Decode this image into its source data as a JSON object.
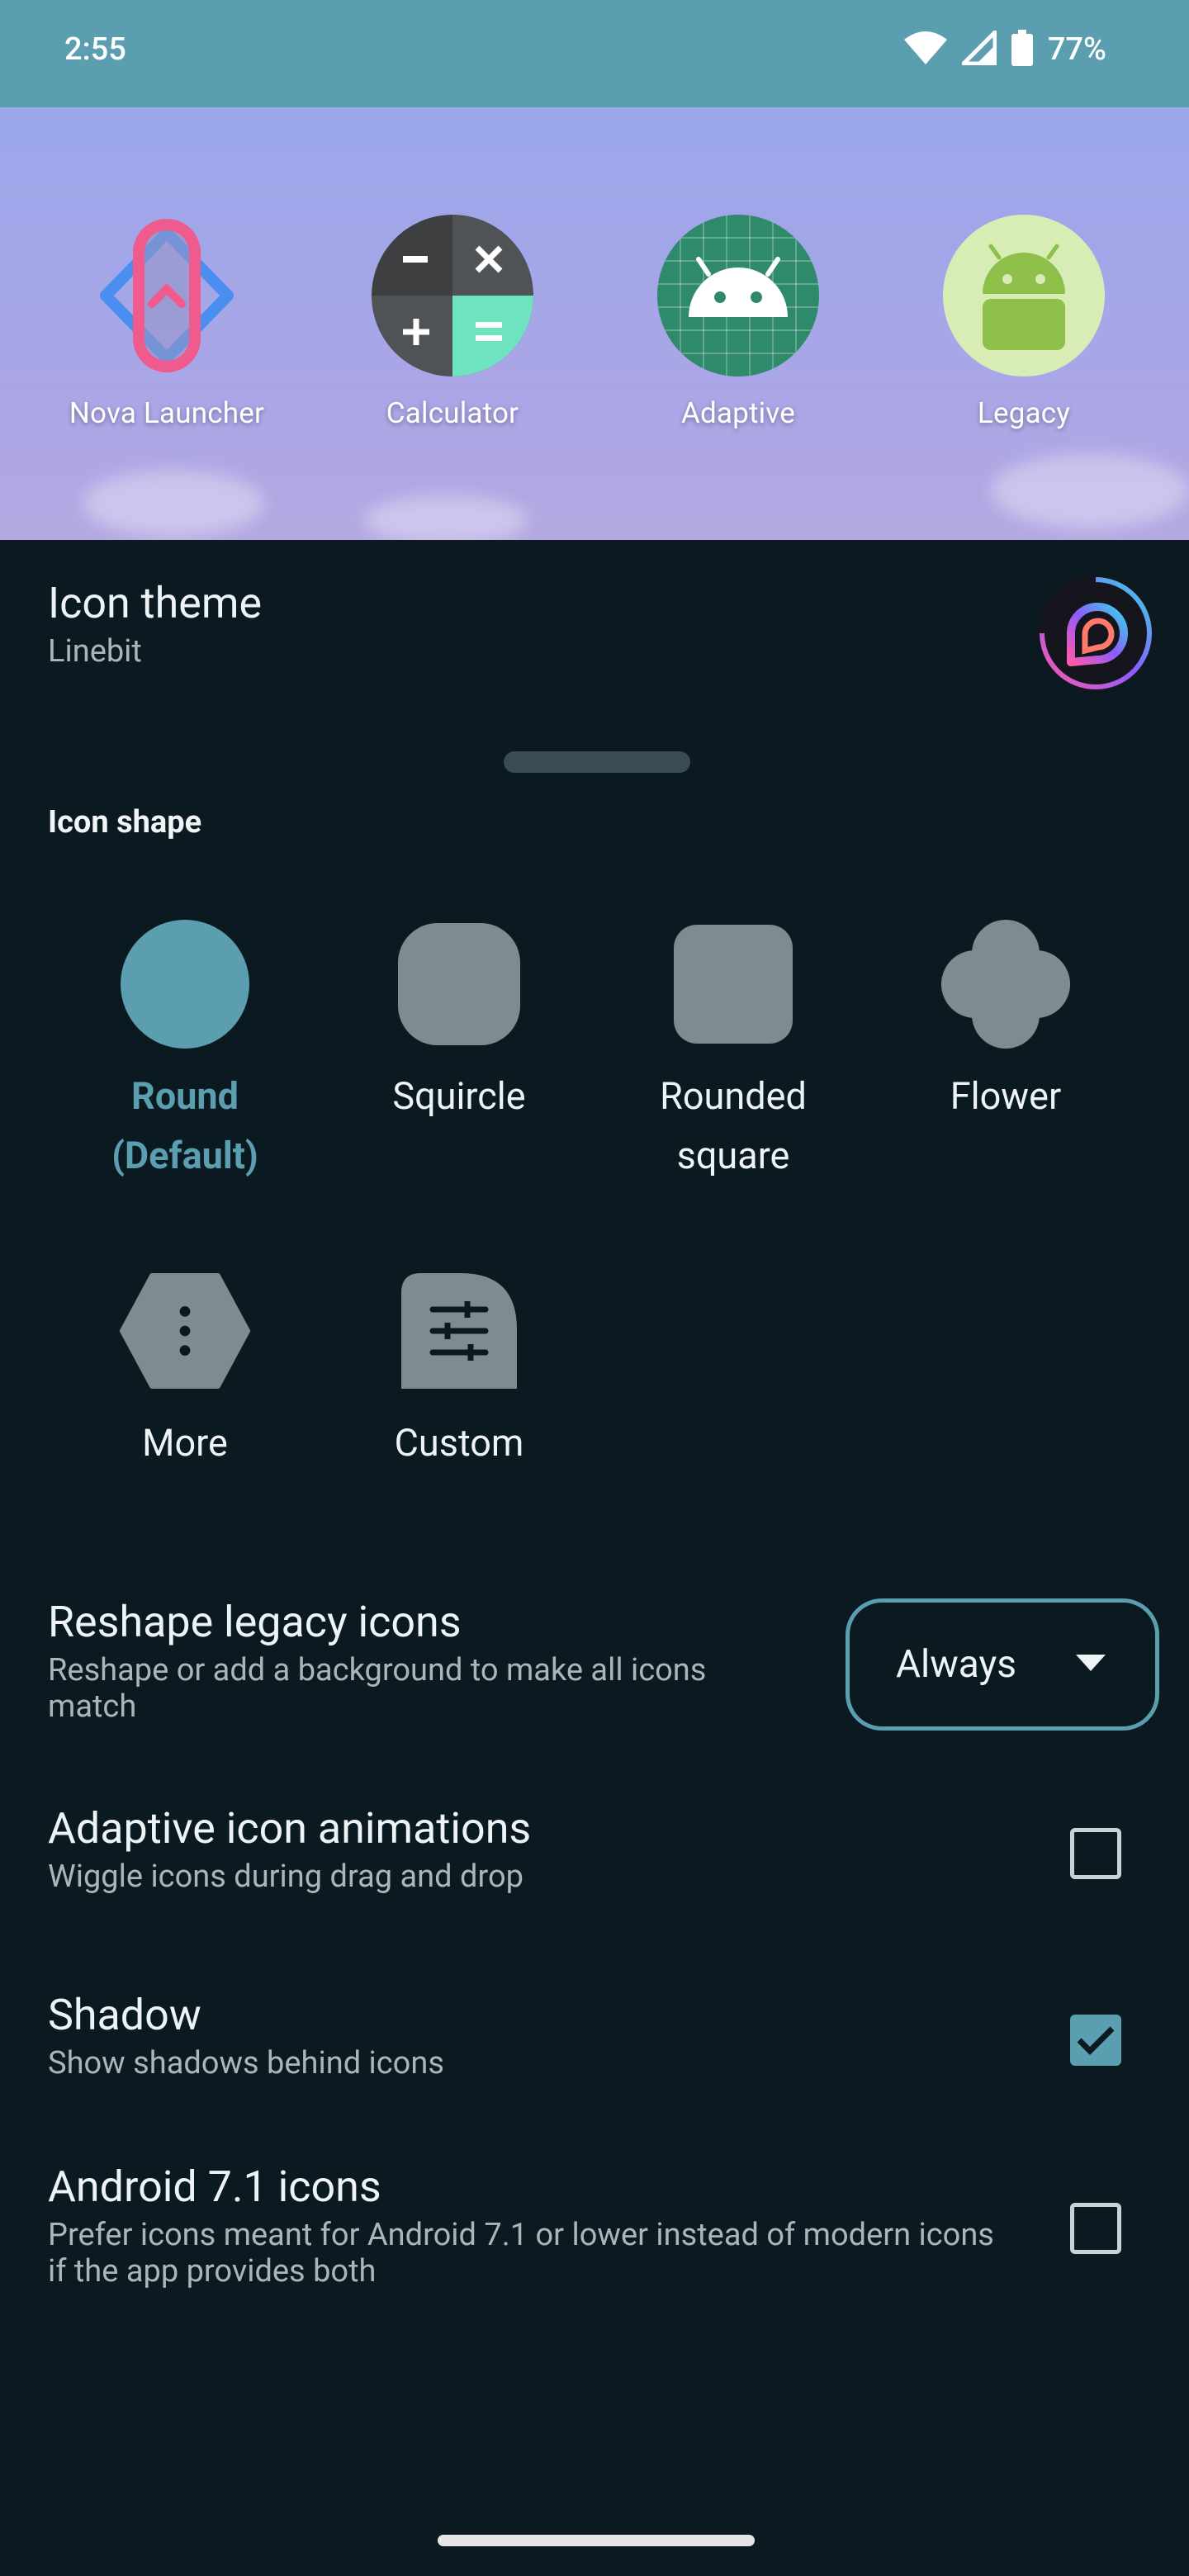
{
  "status_bar": {
    "time": "2:55",
    "battery": "77%"
  },
  "preview_apps": [
    {
      "label": "Nova Launcher"
    },
    {
      "label": "Calculator"
    },
    {
      "label": "Adaptive"
    },
    {
      "label": "Legacy"
    }
  ],
  "icon_theme": {
    "title": "Icon theme",
    "value": "Linebit"
  },
  "icon_shape": {
    "section_label": "Icon shape",
    "options": [
      {
        "line1": "Round",
        "line2": "(Default)",
        "selected": true
      },
      {
        "line1": "Squircle",
        "line2": ""
      },
      {
        "line1": "Rounded",
        "line2": "square"
      },
      {
        "line1": "Flower",
        "line2": ""
      },
      {
        "line1": "More",
        "line2": ""
      },
      {
        "line1": "Custom",
        "line2": ""
      }
    ]
  },
  "reshape": {
    "title": "Reshape legacy icons",
    "subtitle": "Reshape or add a background to make all icons match",
    "selected": "Always"
  },
  "adaptive_animations": {
    "title": "Adaptive icon animations",
    "subtitle": "Wiggle icons during drag and drop",
    "checked": false
  },
  "shadow": {
    "title": "Shadow",
    "subtitle": "Show shadows behind icons",
    "checked": true
  },
  "android71": {
    "title": "Android 7.1 icons",
    "subtitle": "Prefer icons meant for Android 7.1 or lower instead of modern icons if the app provides both",
    "checked": false
  },
  "colors": {
    "accent": "#5a9eaf",
    "background": "#0b1a21",
    "shape_inactive": "#7f8b8f"
  }
}
